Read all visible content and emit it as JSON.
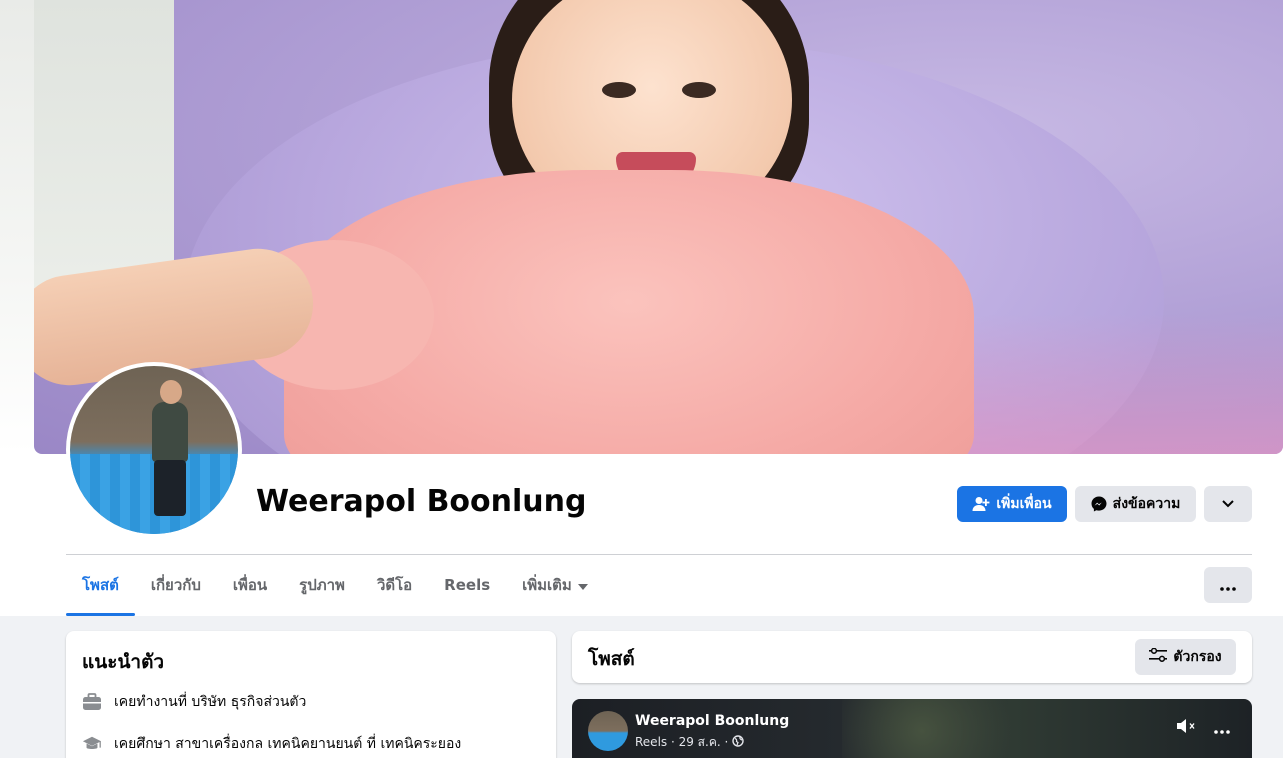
{
  "profile": {
    "name": "Weerapol Boonlung",
    "add_friend_label": "เพิ่มเพื่อน",
    "message_label": "ส่งข้อความ"
  },
  "tabs": [
    {
      "label": "โพสต์",
      "active": true
    },
    {
      "label": "เกี่ยวกับ"
    },
    {
      "label": "เพื่อน"
    },
    {
      "label": "รูปภาพ"
    },
    {
      "label": "วิดีโอ"
    },
    {
      "label": "Reels"
    },
    {
      "label": "เพิ่มเติม"
    }
  ],
  "intro": {
    "title": "แนะนำตัว",
    "items": [
      {
        "icon": "briefcase-icon",
        "text": "เคยทำงานที่ บริษัท ธุรกิจส่วนตัว"
      },
      {
        "icon": "graduation-cap-icon",
        "text": "เคยศึกษา สาขาเครื่องกล เทคนิคยานยนต์ ที่ เทคนิคระยอง"
      }
    ]
  },
  "posts": {
    "title": "โพสต์",
    "filter_label": "ตัวกรอง"
  },
  "post": {
    "author": "Weerapol Boonlung",
    "meta": "Reels · 29 ส.ค. ·"
  },
  "colors": {
    "accent": "#1b74e4",
    "button_gray": "#e4e6eb",
    "background": "#f0f2f5"
  }
}
